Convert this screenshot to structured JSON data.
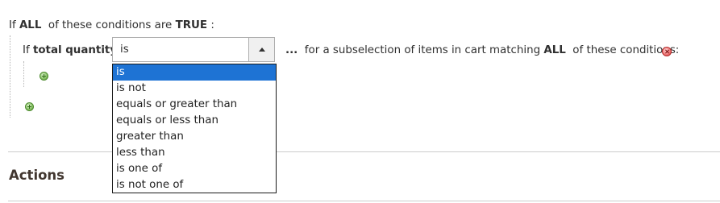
{
  "conditions": {
    "prefix": "If",
    "aggregator": "ALL",
    "middle": "of these conditions are",
    "value": "TRUE",
    "suffix": ":"
  },
  "subselection": {
    "prefix": "If",
    "attribute": "total quantity",
    "operator_value": "is",
    "ellipsis": "...",
    "text": "for a subselection of items in cart matching",
    "aggregator": "ALL",
    "text_end": "of these conditions:"
  },
  "operator_options": [
    "is",
    "is not",
    "equals or greater than",
    "equals or less than",
    "greater than",
    "less than",
    "is one of",
    "is not one of"
  ],
  "selected_option": "is",
  "actions": {
    "title": "Actions"
  },
  "icons": {
    "add": "add-condition-icon",
    "remove": "remove-condition-icon",
    "dropdown_arrow": "chevron-up-icon"
  }
}
